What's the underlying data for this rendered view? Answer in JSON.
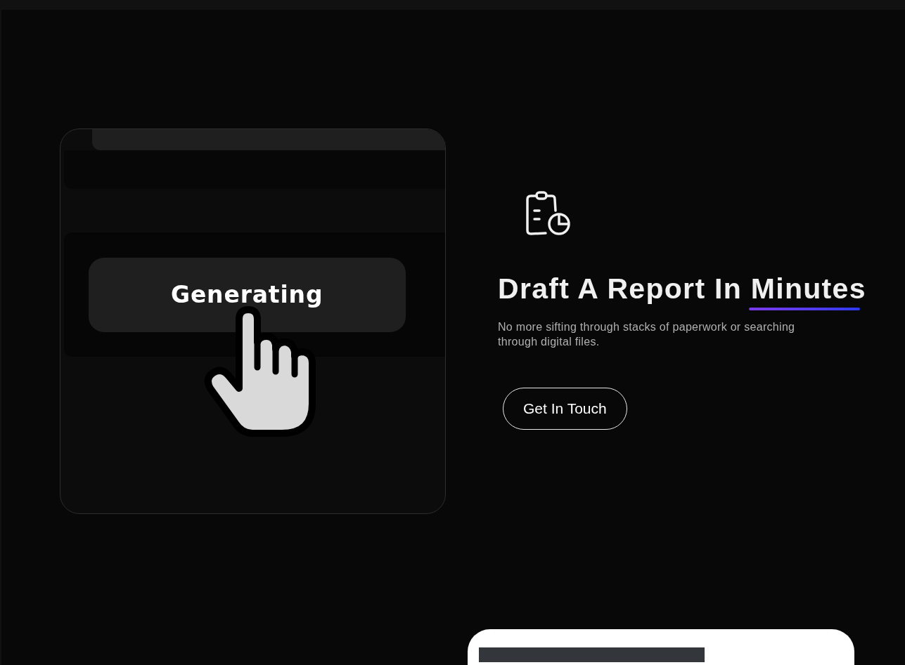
{
  "demo_card": {
    "button": {
      "label": "Generating"
    }
  },
  "feature": {
    "heading": "Draft A Report In Minutes",
    "description": "No more sifting through stacks of paperwork or searching through digital files.",
    "cta": "Get In Touch"
  }
}
